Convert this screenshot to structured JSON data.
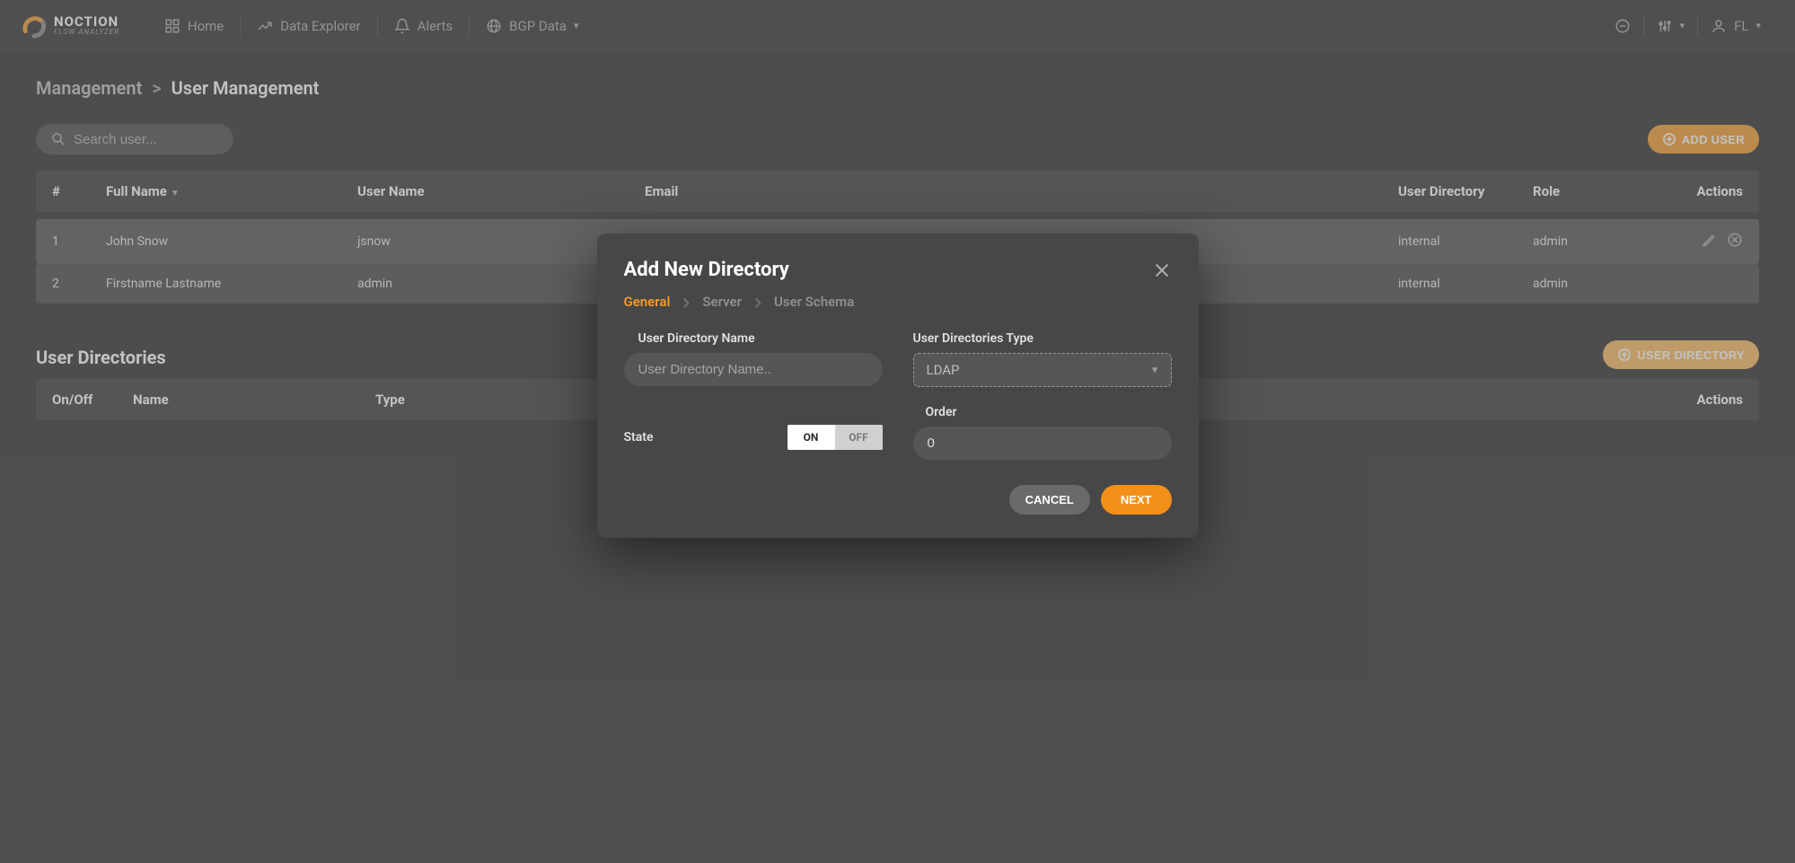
{
  "brand": {
    "name": "NOCTION",
    "sub": "FLOW ANALYZER"
  },
  "nav": {
    "items": [
      {
        "label": "Home"
      },
      {
        "label": "Data Explorer"
      },
      {
        "label": "Alerts"
      },
      {
        "label": "BGP Data"
      }
    ],
    "user_initials": "FL"
  },
  "breadcrumb": {
    "parent": "Management",
    "sep": ">",
    "current": "User Management"
  },
  "search": {
    "placeholder": "Search user..."
  },
  "buttons": {
    "add_user": "ADD USER",
    "user_directory": "USER DIRECTORY",
    "cancel": "CANCEL",
    "next": "NEXT"
  },
  "users_table": {
    "headers": [
      "#",
      "Full Name",
      "User Name",
      "Email",
      "User Directory",
      "Role",
      "Actions"
    ],
    "rows": [
      {
        "n": "1",
        "full_name": "John Snow",
        "user_name": "jsnow",
        "email": "",
        "dir": "internal",
        "role": "admin"
      },
      {
        "n": "2",
        "full_name": "Firstname Lastname",
        "user_name": "admin",
        "email": "",
        "dir": "internal",
        "role": "admin"
      }
    ]
  },
  "dir_section": {
    "title": "User Directories",
    "headers": [
      "On/Off",
      "Name",
      "Type",
      "Actions"
    ]
  },
  "modal": {
    "title": "Add New Directory",
    "steps": [
      "General",
      "Server",
      "User Schema"
    ],
    "fields": {
      "name_label": "User Directory Name",
      "name_placeholder": "User Directory Name..",
      "type_label": "User Directories Type",
      "type_value": "LDAP",
      "state_label": "State",
      "toggle_on": "ON",
      "toggle_off": "OFF",
      "order_label": "Order",
      "order_value": "0"
    }
  }
}
